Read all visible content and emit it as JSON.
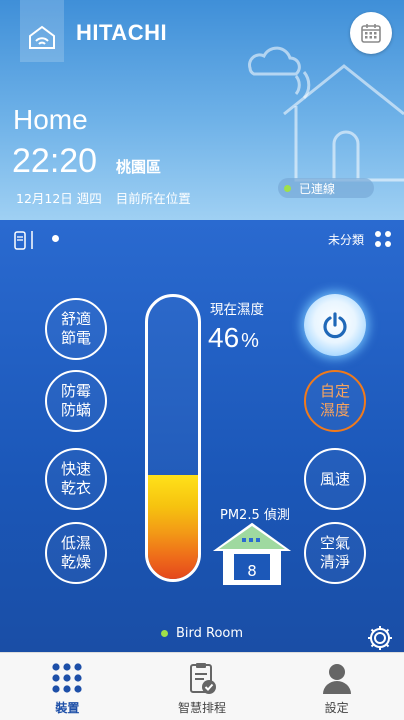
{
  "header": {
    "brand": "HITACHI",
    "home_title": "Home",
    "time": "22:20",
    "city": "桃園區",
    "date": "12月12日 週四",
    "location": "目前所在位置",
    "status": "已連線"
  },
  "device": {
    "category": "未分類",
    "buttons": {
      "comfort": "舒適\n節電",
      "mold": "防霉\n防蟎",
      "quick_dry": "快速\n乾衣",
      "low_humid": "低濕\n乾燥",
      "custom": "自定\n濕度",
      "fan": "風速",
      "air": "空氣\n清淨"
    },
    "humidity_label": "現在濕度",
    "humidity_value": "46",
    "humidity_unit": "%",
    "humidity_level": 0.37,
    "pm_label": "PM2.5 偵測",
    "pm_value": "8",
    "room_name": "Bird Room"
  },
  "nav": {
    "device": "裝置",
    "schedule": "智慧排程",
    "settings": "設定"
  },
  "colors": {
    "accent_blue": "#1d56b4",
    "orange": "#f07a1c",
    "status_green": "#9fe04a"
  }
}
